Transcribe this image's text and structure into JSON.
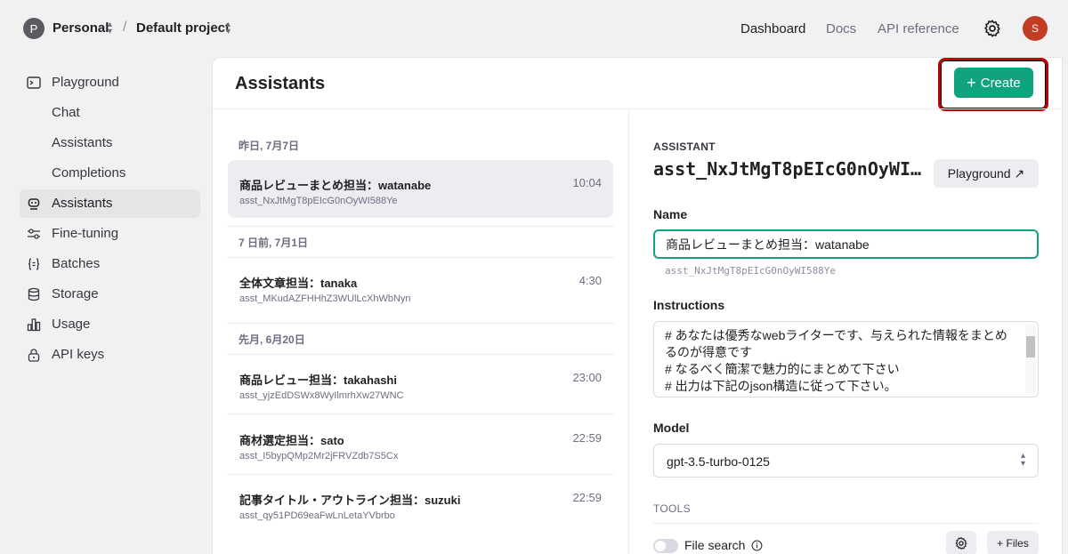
{
  "topbar": {
    "org_initial": "P",
    "org_name": "Personal",
    "project_name": "Default project",
    "nav": [
      "Dashboard",
      "Docs",
      "API reference"
    ],
    "user_initial": "S"
  },
  "sidebar": {
    "items": [
      {
        "label": "Playground",
        "icon": "terminal-icon"
      },
      {
        "label": "Chat"
      },
      {
        "label": "Assistants"
      },
      {
        "label": "Completions"
      },
      {
        "label": "Assistants",
        "icon": "robot-icon",
        "active": true
      },
      {
        "label": "Fine-tuning",
        "icon": "sliders-icon"
      },
      {
        "label": "Batches",
        "icon": "braces-icon"
      },
      {
        "label": "Storage",
        "icon": "database-icon"
      },
      {
        "label": "Usage",
        "icon": "bar-chart-icon"
      },
      {
        "label": "API keys",
        "icon": "lock-icon"
      }
    ]
  },
  "main": {
    "title": "Assistants",
    "create_label": "Create",
    "accent": "#10a37f"
  },
  "list": {
    "groups": [
      {
        "header": "昨日, 7月7日"
      },
      {
        "header": "7 日前, 7月1日"
      },
      {
        "header": "先月, 6月20日"
      }
    ],
    "assistants": [
      {
        "name": "商品レビューまとめ担当：watanabe",
        "time": "10:04",
        "id": "asst_NxJtMgT8pEIcG0nOyWI588Ye"
      },
      {
        "name": "全体文章担当：tanaka",
        "time": "4:30",
        "id": "asst_MKudAZFHHhZ3WUlLcXhWbNyn"
      },
      {
        "name": "商品レビュー担当：takahashi",
        "time": "23:00",
        "id": "asst_yjzEdDSWx8WyIlmrhXw27WNC"
      },
      {
        "name": "商材選定担当：sato",
        "time": "22:59",
        "id": "asst_I5bypQMp2Mr2jFRVZdb7S5Cx"
      },
      {
        "name": "記事タイトル・アウトライン担当：suzuki",
        "time": "22:59",
        "id": "asst_qy51PD69eaFwLnLetaYVbrbo"
      }
    ]
  },
  "detail": {
    "section_label": "ASSISTANT",
    "assistant_id": "asst_NxJtMgT8pEIcG0nOyWI588Ye",
    "playground_label": "Playground ↗",
    "name_label": "Name",
    "name_value": "商品レビューまとめ担当：watanabe",
    "name_sub": "asst_NxJtMgT8pEIcG0nOyWI588Ye",
    "instructions_label": "Instructions",
    "instructions": "# あなたは優秀なwebライターです、与えられた情報をまとめるのが得意です\n# なるべく簡潔で魅力的にまとめて下さい\n# 出力は下記のjson構造に従って下さい。\n以下",
    "model_label": "Model",
    "model_value": "gpt-3.5-turbo-0125",
    "tools_label": "TOOLS",
    "file_search_label": "File search",
    "files_label": "+ Files"
  }
}
